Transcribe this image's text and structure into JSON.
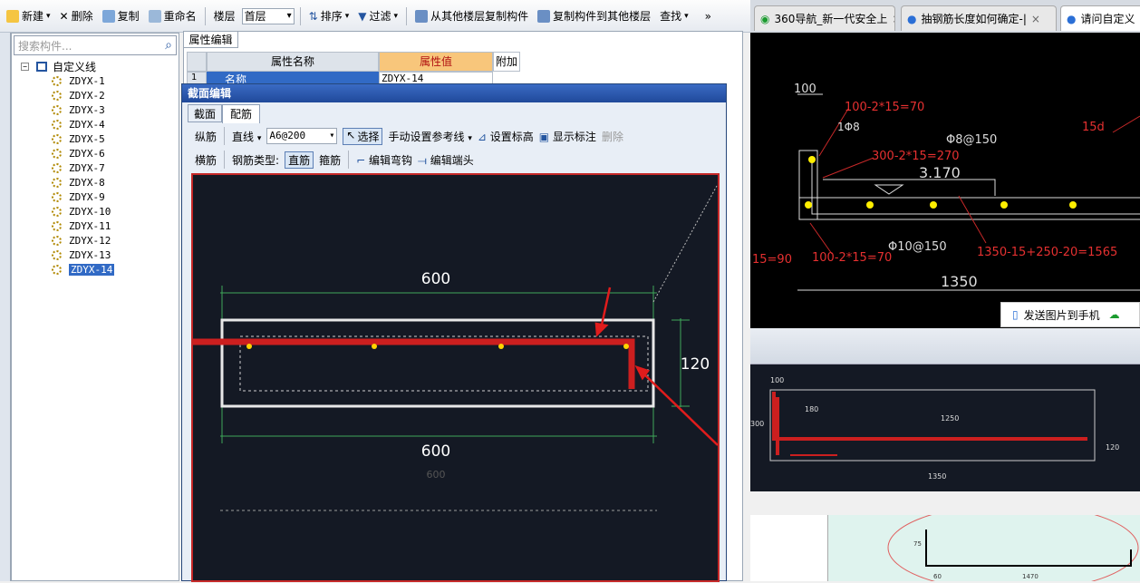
{
  "toolbar": {
    "new": "新建",
    "delete": "删除",
    "copy": "复制",
    "rename": "重命名",
    "floor_label": "楼层",
    "floor_value": "首层",
    "sort": "排序",
    "filter": "过滤",
    "copy_from": "从其他楼层复制构件",
    "copy_to": "复制构件到其他楼层",
    "find": "查找",
    "more": "»"
  },
  "tree": {
    "search_placeholder": "搜索构件...",
    "root": "自定义线",
    "items": [
      "ZDYX-1",
      "ZDYX-2",
      "ZDYX-3",
      "ZDYX-4",
      "ZDYX-5",
      "ZDYX-6",
      "ZDYX-7",
      "ZDYX-8",
      "ZDYX-9",
      "ZDYX-10",
      "ZDYX-11",
      "ZDYX-12",
      "ZDYX-13",
      "ZDYX-14"
    ],
    "selected": "ZDYX-14"
  },
  "prop": {
    "tab": "属性编辑",
    "col_name": "属性名称",
    "col_value": "属性值",
    "col_extra": "附加",
    "row_num": "1",
    "row_name": "名称",
    "row_value": "ZDYX-14"
  },
  "dialog": {
    "title": "截面编辑",
    "tabs": [
      "截面",
      "配筋"
    ],
    "row1": {
      "long_bar": "纵筋",
      "line_type": "直线",
      "bar_spec": "A6@200",
      "select": "选择",
      "manual_ref": "手动设置参考线",
      "set_height": "设置标高",
      "show_dim": "显示标注",
      "delete": "删除"
    },
    "row2": {
      "trans_bar": "横筋",
      "bar_type": "钢筋类型:",
      "straight": "直筋",
      "stirrup": "箍筋",
      "edit_hook": "编辑弯钩",
      "edit_end": "编辑端头"
    },
    "dims": {
      "top": "600",
      "bottom": "600",
      "bottom2": "600",
      "right": "120"
    }
  },
  "browser": {
    "tabs": [
      "360导航_新一代安全上",
      "抽钢筋长度如何确定-|",
      "请问自定义"
    ],
    "send_btn": "发送图片到手机"
  },
  "cad": {
    "labels": [
      "100",
      "100-2*15=70",
      "1Φ8",
      "Φ8@150",
      "300-2*15=270",
      "3.170",
      "15d",
      "15=90",
      "100-2*15=70",
      "Φ10@150",
      "1350-15+250-20=1565",
      "1350"
    ]
  },
  "thumb": {
    "dims": [
      "100",
      "300",
      "180",
      "1250",
      "120",
      "1350",
      "1470",
      "60",
      "75"
    ]
  }
}
